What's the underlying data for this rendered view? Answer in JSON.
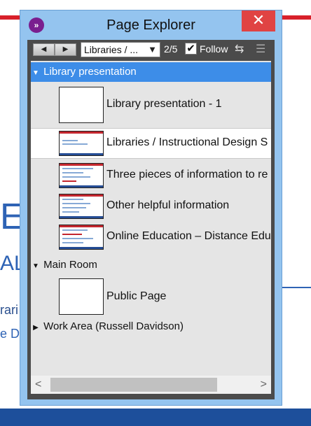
{
  "window": {
    "title": "Page Explorer",
    "close_glyph": "✕",
    "logo_glyph": "»",
    "accent_color": "#3d8de8"
  },
  "toolbar": {
    "prev_glyph": "◀",
    "next_glyph": "▶",
    "selected_option": "Libraries / ...",
    "dropdown_glyph": "▼",
    "page_counter": "2/5",
    "follow_checked": true,
    "follow_check_glyph": "✔",
    "follow_label": "Follow",
    "swap_glyph": "⇆",
    "menu_glyph": "☰"
  },
  "tree": {
    "groups": [
      {
        "name": "Library presentation",
        "expanded": true,
        "pages": [
          {
            "label": "Library presentation -  1",
            "thumb": "blank-icon"
          },
          {
            "label": "Libraries / Instructional Design S",
            "thumb": "slide-icon",
            "selected": true
          },
          {
            "label": "Three pieces of information to re",
            "thumb": "slide-icon"
          },
          {
            "label": "Other helpful information",
            "thumb": "slide-icon"
          },
          {
            "label": "Online Education – Distance Edu",
            "thumb": "slide-icon"
          }
        ]
      },
      {
        "name": "Main Room",
        "expanded": true,
        "pages": [
          {
            "label": "Public Page",
            "thumb": "blank-icon"
          }
        ]
      },
      {
        "name": "Work Area (Russell Davidson)",
        "expanded": false,
        "pages": []
      }
    ],
    "caret_expanded": "▼",
    "caret_collapsed": "▶"
  },
  "scrollbar": {
    "left_glyph": "<",
    "right_glyph": ">"
  },
  "background": {
    "big_text": "E",
    "mid_text": "AL",
    "line1": "rari",
    "line2": "e D"
  }
}
